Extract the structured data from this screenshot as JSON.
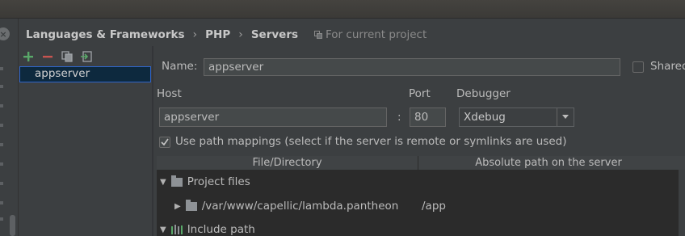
{
  "breadcrumb": {
    "items": [
      "Languages & Frameworks",
      "PHP",
      "Servers"
    ],
    "separator": "›",
    "scope_note": "For current project"
  },
  "servers": {
    "list": [
      "appserver"
    ],
    "selected": "appserver"
  },
  "form": {
    "name_label": "Name:",
    "name_value": "appserver",
    "shared_label": "Shared",
    "shared_checked": false,
    "host_label": "Host",
    "host_value": "appserver",
    "port_separator": ":",
    "port_label": "Port",
    "port_value": "80",
    "debugger_label": "Debugger",
    "debugger_value": "Xdebug",
    "path_mappings_label": "Use path mappings (select if the server is remote or symlinks are used)",
    "path_mappings_checked": true
  },
  "mappings": {
    "columns": [
      "File/Directory",
      "Absolute path on the server"
    ],
    "groups": [
      {
        "label": "Project files",
        "expanded": true
      },
      {
        "label": "Include path",
        "expanded": true
      }
    ],
    "rows": [
      {
        "file": "/var/www/capellic/lambda.pantheon",
        "server_path": "/app"
      }
    ]
  },
  "colors": {
    "background": "#3c3f41",
    "selection": "#0d293e",
    "selection_border": "#2f65ca",
    "add_icon": "#59a869",
    "remove_icon": "#c75450"
  }
}
